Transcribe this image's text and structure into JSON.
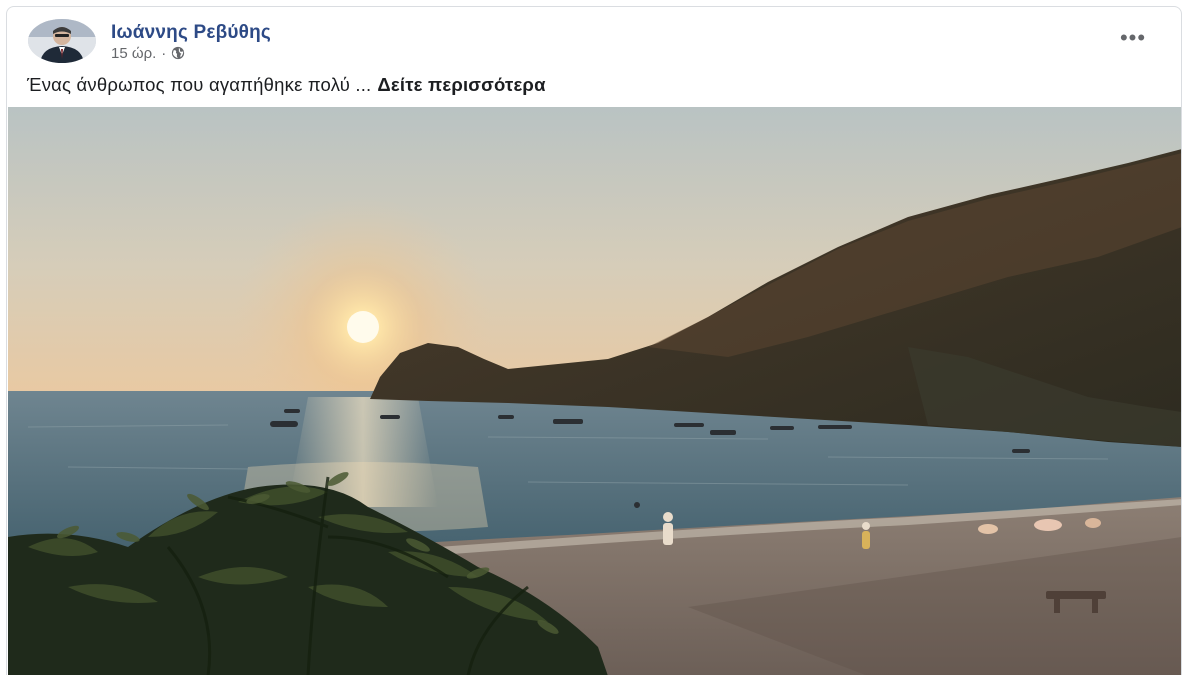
{
  "post": {
    "author": "Ιωάννης Ρεβύθης",
    "time": "15 ώρ.",
    "separator": "·",
    "privacy_icon": "globe-icon",
    "more_icon": "more-options-icon",
    "more_glyph": "•••",
    "caption_text": "Ένας άνθρωπος που αγαπήθηκε πολύ ...",
    "see_more": "Δείτε περισσότερα"
  },
  "colors": {
    "author_name": "#2d4a86",
    "secondary_text": "#65676b",
    "primary_text": "#1c1e21",
    "card_border": "#dadde1"
  }
}
